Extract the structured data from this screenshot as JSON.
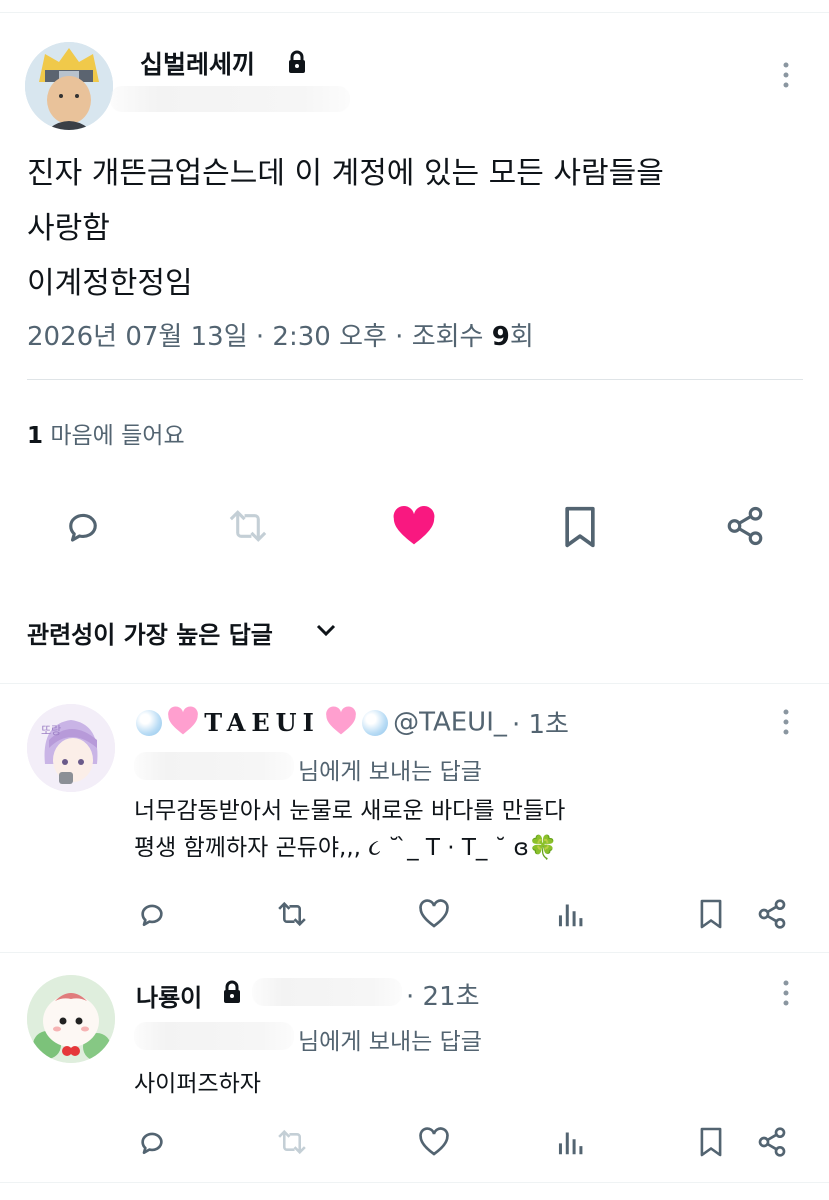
{
  "post": {
    "author_name": "십벌레세끼",
    "text_lines": [
      "진자 개뜬금업슨느데 이 계정에 있는 모든 사람들을",
      "사랑함",
      "이계정한정임"
    ],
    "meta_date": "2026년 07월 13일 · 2:30 오후 · 조회수 ",
    "meta_views": "9",
    "meta_views_suffix": "회",
    "like_count": "1",
    "like_label": " 마음에 들어요"
  },
  "replies_header": "관련성이 가장 높은 답글",
  "replies": [
    {
      "display_name": "TAEUI",
      "handle": "@TAEUI_",
      "time": "· 1초",
      "reply_to": "님에게 보내는 답글",
      "text_lines": [
        "너무감동받아서 눈물로 새로운 바다를 만들다",
        "평생 함께하자 곤듀야,,, ૮ ˘ ̀_ T · T_ ˘ ɞ🍀"
      ]
    },
    {
      "display_name": "나룡이",
      "time": "· 21초",
      "reply_to": "님에게 보내는 답글",
      "text_lines": [
        "사이퍼즈하자"
      ]
    }
  ],
  "colors": {
    "like": "#f91880",
    "icon": "#536471",
    "text": "#0f1419",
    "muted": "#536471"
  },
  "icons": [
    "lock-icon",
    "more-icon",
    "reply-icon",
    "retweet-icon",
    "heart-icon",
    "bookmark-icon",
    "share-icon",
    "chevron-down-icon",
    "views-icon"
  ]
}
